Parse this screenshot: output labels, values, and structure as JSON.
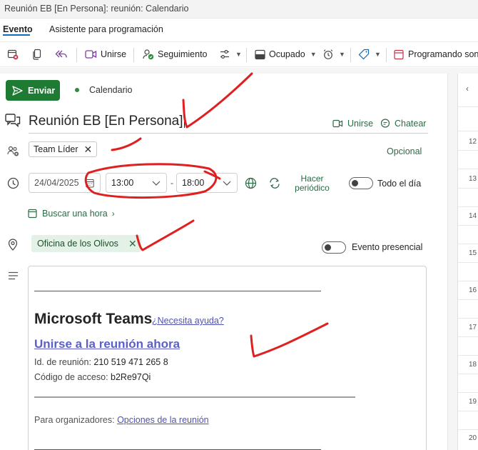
{
  "window": {
    "title": "Reunión EB [En Persona]: reunión: Calendario"
  },
  "tabs": [
    {
      "label": "Evento",
      "active": true
    },
    {
      "label": "Asistente para programación",
      "active": false
    }
  ],
  "ribbon": {
    "join_label": "Unirse",
    "tracking_label": "Seguimiento",
    "busy_label": "Ocupado",
    "scheduling_label": "Programando sonc"
  },
  "header": {
    "send_label": "Enviar",
    "calendar_label": "Calendario"
  },
  "event": {
    "title": "Reunión EB [En Persona]",
    "join_label": "Unirse",
    "chat_label": "Chatear",
    "attendee": "Team Líder",
    "optional_label": "Opcional",
    "date": "24/04/2025",
    "start_time": "13:00",
    "end_time": "18:00",
    "time_separator": "-",
    "recurring_label": "Hacer periódico",
    "all_day_label": "Todo el día",
    "find_time_label": "Buscar una hora",
    "location": "Oficina de los Olivos",
    "in_person_label": "Evento presencial",
    "all_day": false,
    "in_person": false
  },
  "body": {
    "teams_title": "Microsoft Teams",
    "help_link": "¿Necesita ayuda?",
    "join_now": "Unirse a la reunión ahora",
    "meeting_id_label": "Id. de reunión:",
    "meeting_id": "210 519 471 265 8",
    "passcode_label": "Código de acceso:",
    "passcode": "b2Re97Qi",
    "organizers_label": "Para organizadores:",
    "meeting_options_link": "Opciones de la reunión"
  },
  "calendar_panel": {
    "hours": [
      "12",
      "13",
      "14",
      "15",
      "16",
      "17",
      "18",
      "19",
      "20"
    ]
  },
  "colors": {
    "send_button": "#1e7b34",
    "accent_green": "#2b6a45",
    "teams_purple": "#5b5fc7",
    "annotation_red": "#e02020"
  }
}
